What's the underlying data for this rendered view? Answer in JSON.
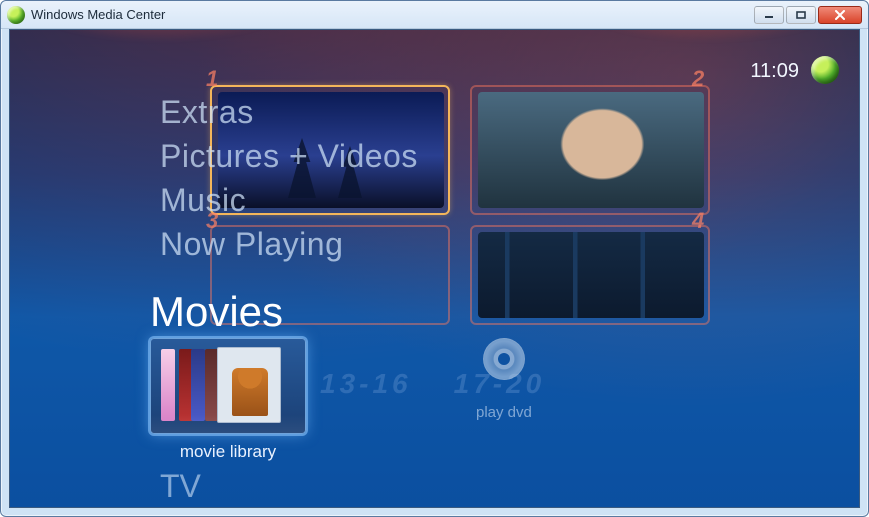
{
  "window": {
    "title": "Windows Media Center"
  },
  "header": {
    "clock": "11:09"
  },
  "bg_numbers": {
    "n1": "1",
    "n2": "2",
    "n3": "3",
    "n4": "4"
  },
  "ghost": {
    "a": "13-16",
    "b": "17-20"
  },
  "menu": {
    "above": [
      {
        "label": "Extras"
      },
      {
        "label": "Pictures + Videos"
      },
      {
        "label": "Music"
      },
      {
        "label": "Now Playing"
      }
    ],
    "current_section": "Movies",
    "below": [
      {
        "label": "TV"
      }
    ]
  },
  "tiles": {
    "movie_library": {
      "label": "movie library"
    },
    "play_dvd": {
      "label": "play dvd"
    }
  }
}
